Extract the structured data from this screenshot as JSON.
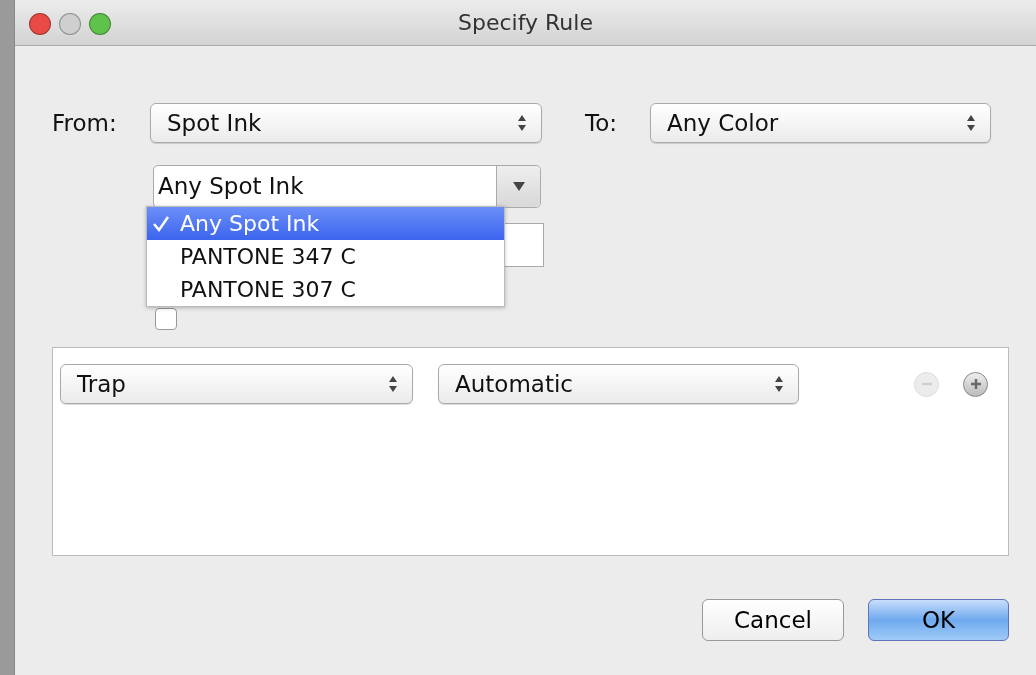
{
  "window": {
    "title": "Specify Rule"
  },
  "from": {
    "label": "From:",
    "value": "Spot Ink"
  },
  "to": {
    "label": "To:",
    "value": "Any Color"
  },
  "ink_combo": {
    "value": "Any Spot Ink",
    "expanded": true,
    "options": [
      {
        "label": "Any Spot Ink",
        "selected": true
      },
      {
        "label": "PANTONE 347 C",
        "selected": false
      },
      {
        "label": "PANTONE 307 C",
        "selected": false
      }
    ]
  },
  "pure_checkbox": {
    "checked": false
  },
  "rule": {
    "action": "Trap",
    "mode": "Automatic",
    "remove_disabled": true,
    "add_disabled": false
  },
  "buttons": [
    {
      "label": "Cancel",
      "default": false
    },
    {
      "label": "OK",
      "default": true
    }
  ]
}
